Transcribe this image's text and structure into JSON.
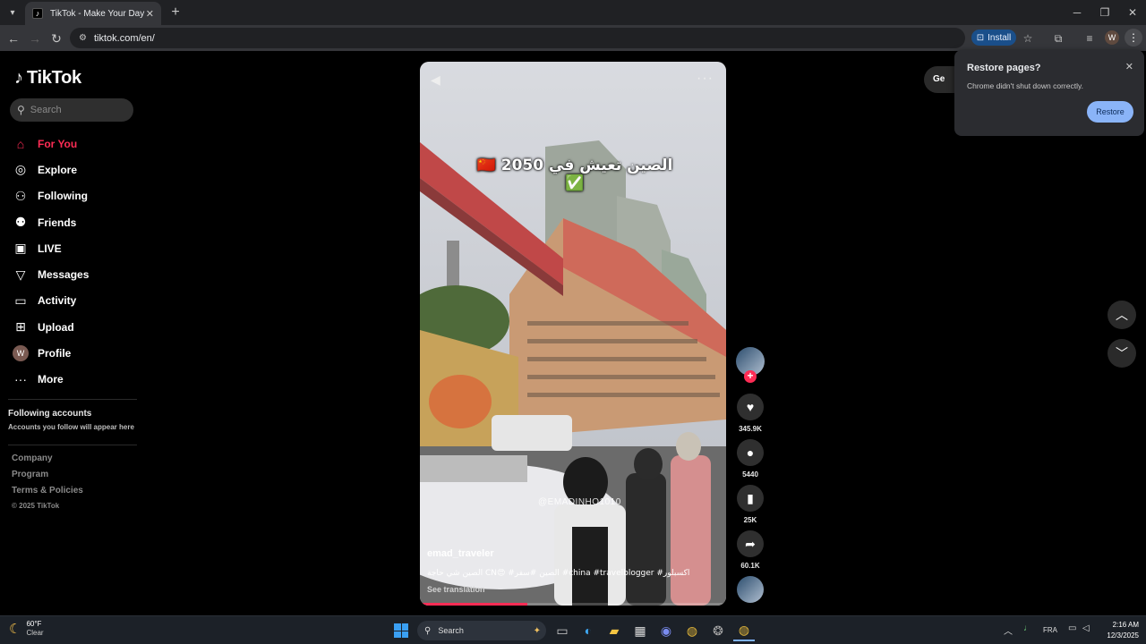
{
  "browser": {
    "tab_title": "TikTok - Make Your Day",
    "tab_favicon": "tiktok-icon",
    "url": "tiktok.com/en/",
    "install_label": "Install",
    "profile_initial": "W"
  },
  "sidebar": {
    "logo_text": "TikTok",
    "search_placeholder": "Search",
    "items": [
      {
        "label": "For You",
        "icon": "home-icon",
        "active": true
      },
      {
        "label": "Explore",
        "icon": "compass-icon"
      },
      {
        "label": "Following",
        "icon": "person-plus-icon"
      },
      {
        "label": "Friends",
        "icon": "friends-icon"
      },
      {
        "label": "LIVE",
        "icon": "live-icon"
      },
      {
        "label": "Messages",
        "icon": "paper-plane-icon"
      },
      {
        "label": "Activity",
        "icon": "chat-bubble-icon"
      },
      {
        "label": "Upload",
        "icon": "plus-square-icon"
      },
      {
        "label": "Profile",
        "icon": "avatar",
        "initial": "W"
      },
      {
        "label": "More",
        "icon": "ellipsis-icon"
      }
    ],
    "following_accounts_title": "Following accounts",
    "following_accounts_sub": "Accounts you follow will appear here",
    "footer": [
      "Company",
      "Program",
      "Terms & Policies"
    ],
    "copyright": "© 2025 TikTok"
  },
  "video": {
    "overlay_caption": "الصين تعيش في 2050 🇨🇳✅",
    "watermark": "@EMADINHO1010",
    "author": "emad_traveler",
    "description": "الصين شي حاجة CN😍 #الصين #سفر #china #travelblogger #اكسبلور",
    "see_translation": "See translation",
    "progress": 0.35
  },
  "actions": {
    "likes": "345.9K",
    "comments": "5440",
    "saves": "25K",
    "shares": "60.1K"
  },
  "right": {
    "get_app_label": "Ge"
  },
  "restore_popup": {
    "title": "Restore pages?",
    "message": "Chrome didn't shut down correctly.",
    "button": "Restore"
  },
  "taskbar": {
    "weather_temp": "60°F",
    "weather_desc": "Clear",
    "search_label": "Search",
    "language": "FRA",
    "time": "2:16 AM",
    "date": "12/3/2025"
  },
  "colors": {
    "accent": "#fe2c55",
    "restore_button": "#8ab4f8"
  }
}
